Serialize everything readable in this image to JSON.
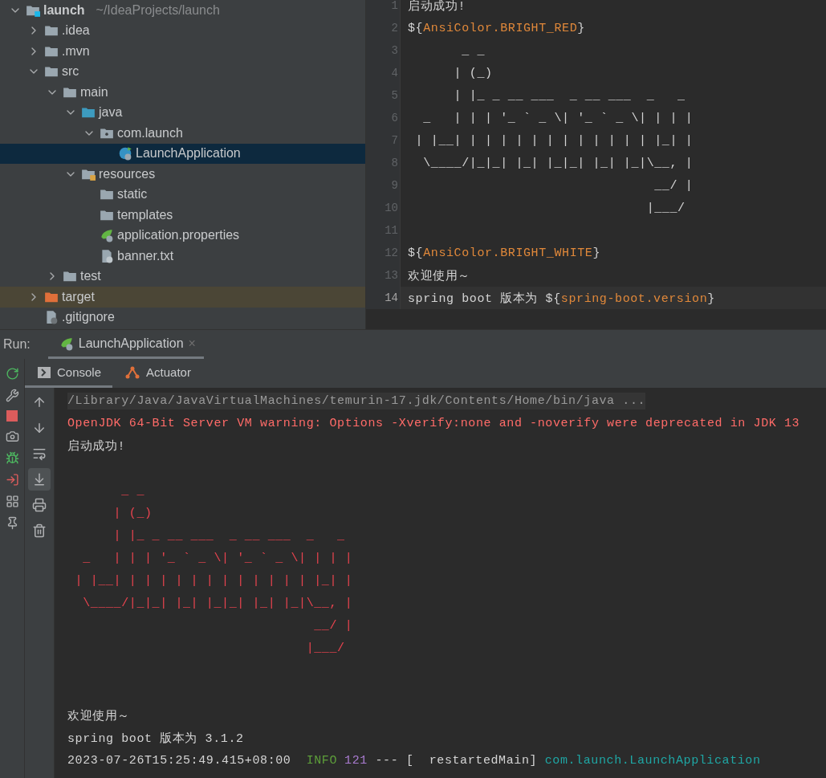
{
  "project_tree": {
    "items": [
      {
        "label": "launch",
        "path": "~/IdeaProjects/launch",
        "kind": "module",
        "expanded": true,
        "selected": false,
        "children": [
          {
            "label": ".idea",
            "kind": "folder",
            "expanded": false,
            "selected": false
          },
          {
            "label": ".mvn",
            "kind": "folder",
            "expanded": false,
            "selected": false
          },
          {
            "label": "src",
            "kind": "folder",
            "expanded": true,
            "selected": false,
            "children": [
              {
                "label": "main",
                "kind": "folder",
                "expanded": true,
                "selected": false,
                "children": [
                  {
                    "label": "java",
                    "kind": "source-folder",
                    "expanded": true,
                    "selected": false,
                    "children": [
                      {
                        "label": "com.launch",
                        "kind": "package",
                        "expanded": true,
                        "selected": false,
                        "children": [
                          {
                            "label": "LaunchApplication",
                            "kind": "spring-class",
                            "selected": true
                          }
                        ]
                      }
                    ]
                  },
                  {
                    "label": "resources",
                    "kind": "resources-folder",
                    "expanded": true,
                    "selected": false,
                    "children": [
                      {
                        "label": "static",
                        "kind": "folder",
                        "selected": false
                      },
                      {
                        "label": "templates",
                        "kind": "folder",
                        "selected": false
                      },
                      {
                        "label": "application.properties",
                        "kind": "spring-properties",
                        "selected": false
                      },
                      {
                        "label": "banner.txt",
                        "kind": "text-file",
                        "selected": false
                      }
                    ]
                  }
                ]
              },
              {
                "label": "test",
                "kind": "folder",
                "expanded": false,
                "selected": false
              }
            ]
          },
          {
            "label": "target",
            "kind": "excluded-folder",
            "expanded": false,
            "selected": false
          },
          {
            "label": ".gitignore",
            "kind": "ignored-file",
            "selected": false
          }
        ]
      }
    ]
  },
  "editor": {
    "lines": [
      {
        "number": "1",
        "current": false,
        "parts": [
          {
            "text": "启动成功!",
            "kind": "plain"
          }
        ]
      },
      {
        "number": "2",
        "current": false,
        "parts": [
          {
            "text": "${",
            "kind": "plain"
          },
          {
            "text": "AnsiColor.BRIGHT_RED",
            "kind": "key"
          },
          {
            "text": "}",
            "kind": "plain"
          }
        ]
      },
      {
        "number": "3",
        "current": false,
        "parts": [
          {
            "text": "       _ _",
            "kind": "plain"
          }
        ]
      },
      {
        "number": "4",
        "current": false,
        "parts": [
          {
            "text": "      | (_)",
            "kind": "plain"
          }
        ]
      },
      {
        "number": "5",
        "current": false,
        "parts": [
          {
            "text": "      | |_ _ __ ___  _ __ ___  _   _",
            "kind": "plain"
          }
        ]
      },
      {
        "number": "6",
        "current": false,
        "parts": [
          {
            "text": "  _   | | | '_ ` _ \\| '_ ` _ \\| | | |",
            "kind": "plain"
          }
        ]
      },
      {
        "number": "7",
        "current": false,
        "parts": [
          {
            "text": " | |__| | | | | | | | | | | | | |_| |",
            "kind": "plain"
          }
        ]
      },
      {
        "number": "8",
        "current": false,
        "parts": [
          {
            "text": "  \\____/|_|_| |_| |_|_| |_| |_|\\__, |",
            "kind": "plain"
          }
        ]
      },
      {
        "number": "9",
        "current": false,
        "parts": [
          {
            "text": "                                __/ |",
            "kind": "plain"
          }
        ]
      },
      {
        "number": "10",
        "current": false,
        "parts": [
          {
            "text": "                               |___/",
            "kind": "plain"
          }
        ]
      },
      {
        "number": "11",
        "current": false
      },
      {
        "number": "12",
        "current": false,
        "parts": [
          {
            "text": "${",
            "kind": "plain"
          },
          {
            "text": "AnsiColor.BRIGHT_WHITE",
            "kind": "key"
          },
          {
            "text": "}",
            "kind": "plain"
          }
        ]
      },
      {
        "number": "13",
        "current": false,
        "parts": [
          {
            "text": "欢迎使用～",
            "kind": "plain"
          }
        ]
      },
      {
        "number": "14",
        "current": true,
        "parts": [
          {
            "text": "spring boot 版本为 ${",
            "kind": "plain"
          },
          {
            "text": "spring-boot.version",
            "kind": "key"
          },
          {
            "text": "}",
            "kind": "plain"
          }
        ]
      }
    ]
  },
  "run_panel": {
    "label": "Run:",
    "tabs": [
      {
        "label": "LaunchApplication",
        "selected": true,
        "close": "×"
      }
    ],
    "side_tools": [
      {
        "kind": "rerun"
      },
      {
        "kind": "wrench"
      },
      {
        "kind": "stop"
      },
      {
        "kind": "camera"
      },
      {
        "kind": "debug"
      },
      {
        "kind": "exit"
      },
      {
        "kind": "layout"
      },
      {
        "kind": "pin"
      }
    ],
    "subtabs": [
      {
        "label": "Console",
        "kind": "console",
        "selected": true
      },
      {
        "label": "Actuator",
        "kind": "actuator",
        "selected": false
      }
    ],
    "console_tools": [
      {
        "kind": "up",
        "selected": false
      },
      {
        "kind": "down",
        "selected": false
      },
      {
        "kind": "wrap",
        "selected": false
      },
      {
        "kind": "scroll-end",
        "selected": true
      },
      {
        "kind": "print",
        "selected": false
      },
      {
        "kind": "clear",
        "selected": false
      }
    ],
    "console_lines": [
      {
        "parts": [
          {
            "text": "/Library/Java/JavaVirtualMachines/temurin-17.jdk/Contents/Home/bin/java ...",
            "kind": "folded"
          }
        ]
      },
      {
        "parts": [
          {
            "text": "OpenJDK 64-Bit Server VM warning: Options -Xverify:none and -noverify were deprecated in JDK 13",
            "kind": "error"
          }
        ]
      },
      {
        "parts": [
          {
            "text": "启动成功!",
            "kind": "plain"
          }
        ]
      },
      {
        "kind": "blank"
      },
      {
        "parts": [
          {
            "text": "       _ _",
            "kind": "art"
          }
        ]
      },
      {
        "parts": [
          {
            "text": "      | (_)",
            "kind": "art"
          }
        ]
      },
      {
        "parts": [
          {
            "text": "      | |_ _ __ ___  _ __ ___  _   _",
            "kind": "art"
          }
        ]
      },
      {
        "parts": [
          {
            "text": "  _   | | | '_ ` _ \\| '_ ` _ \\| | | |",
            "kind": "art"
          }
        ]
      },
      {
        "parts": [
          {
            "text": " | |__| | | | | | | | | | | | | |_| |",
            "kind": "art"
          }
        ]
      },
      {
        "parts": [
          {
            "text": "  \\____/|_|_| |_| |_|_| |_| |_|\\__, |",
            "kind": "art"
          }
        ]
      },
      {
        "parts": [
          {
            "text": "                                __/ |",
            "kind": "art"
          }
        ]
      },
      {
        "parts": [
          {
            "text": "                               |___/",
            "kind": "art"
          }
        ]
      },
      {
        "kind": "blank"
      },
      {
        "kind": "blank"
      },
      {
        "parts": [
          {
            "text": "欢迎使用～",
            "kind": "plain"
          }
        ]
      },
      {
        "parts": [
          {
            "text": "spring boot 版本为 3.1.2",
            "kind": "plain"
          }
        ]
      },
      {
        "parts": [
          {
            "text": "2023-07-26T15:25:49.415+08:00  ",
            "kind": "plain"
          },
          {
            "text": "INFO",
            "kind": "info"
          },
          {
            "text": "121",
            "kind": "pid"
          },
          {
            "text": " --- [  restartedMain] ",
            "kind": "plain"
          },
          {
            "text": "com.launch.LaunchApplication",
            "kind": "logger"
          }
        ]
      }
    ]
  }
}
